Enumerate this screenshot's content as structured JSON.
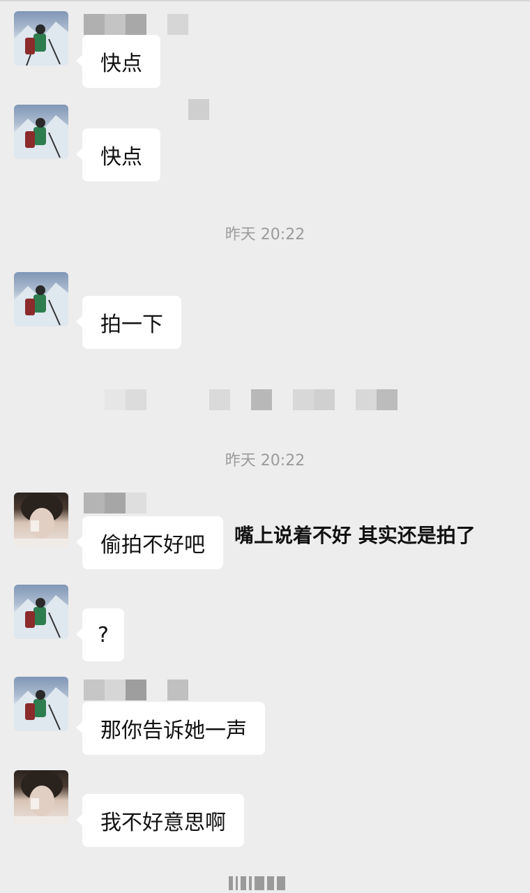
{
  "messages": [
    {
      "text": "快点"
    },
    {
      "text": "快点"
    },
    {
      "text": "拍一下"
    },
    {
      "text": "偷拍不好吧"
    },
    {
      "text": "?"
    },
    {
      "text": "那你告诉她一声"
    },
    {
      "text": "我不好意思啊"
    }
  ],
  "timestamps": [
    "昨天 20:22",
    "昨天 20:22"
  ],
  "caption": "嘴上说着不好 其实还是拍了"
}
